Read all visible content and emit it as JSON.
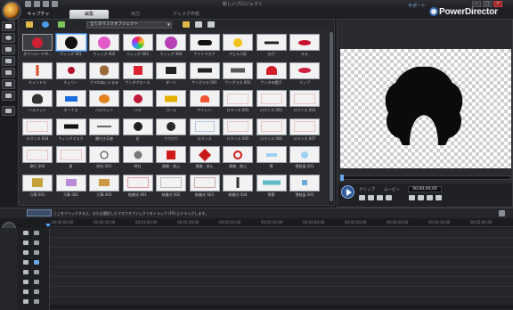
{
  "window": {
    "title": "新しいプロジェクト",
    "brand": "PowerDirector",
    "help_label": "サポート",
    "min": "−",
    "max": "□",
    "close": "×"
  },
  "tabs": [
    "キャプチャ",
    "編集",
    "出力",
    "ディスク作成"
  ],
  "library": {
    "filter": "全てのマスクオブジェクト",
    "tiles": [
      "ダウンロード中...",
      "ウィッグ 001",
      "ウィッグ 002",
      "ウィッグ 003",
      "ウィッグ 004",
      "ナイトマスク",
      "アヒル人形",
      "ひげ",
      "キス",
      "キャンドル",
      "チェリー",
      "クマのぬいぐるみ",
      "サンタクロース",
      "ダーツ",
      "サングラス 001",
      "サングラス 002",
      "サンタの帽子",
      "リップ",
      "ヘルメット",
      "ボーナス",
      "ハロウィン",
      "バラ",
      "ゴール",
      "サイレン",
      "ロマンス 001",
      "ロマンス 002",
      "ロマンス 003",
      "ロマンス 004",
      "ウィンクマスク",
      "鎖付き天使",
      "花",
      "フクロウ",
      "ロマンス",
      "ロマンス 005",
      "ロマンス 006",
      "ロマンス 007",
      "旅行 004",
      "夏",
      "時計 001",
      "時計",
      "標識 - 禁止",
      "標識 - 停止",
      "標識 - 禁止",
      "雪",
      "雪結晶 001",
      "万華 001",
      "万華 002",
      "万華 003",
      "結婚式 001",
      "結婚式 002",
      "結婚式 003",
      "結婚式 004",
      "季節",
      "雪結晶 001"
    ]
  },
  "preview": {
    "mode_clip": "クリップ",
    "mode_movie": "ムービー",
    "timecode": "00;00;00;00"
  },
  "timeline": {
    "hint": "ここをクリックすると、または選択したマスクオブジェクトをトラック (F9) にドラッグします。",
    "ruler": [
      "00;00;00;00",
      "00;00;30;00",
      "00;01;00;00",
      "00;01;30;00",
      "00;02;00;00",
      "00;02;30;00",
      "00;03;00;00",
      "00;03;30;00",
      "00;04;00;00",
      "00;04;30;00",
      "00;05;00;00"
    ]
  },
  "colors": {
    "accent": "#3b78c4",
    "background": "#1b1c1f",
    "panel": "#2a2b2f"
  }
}
